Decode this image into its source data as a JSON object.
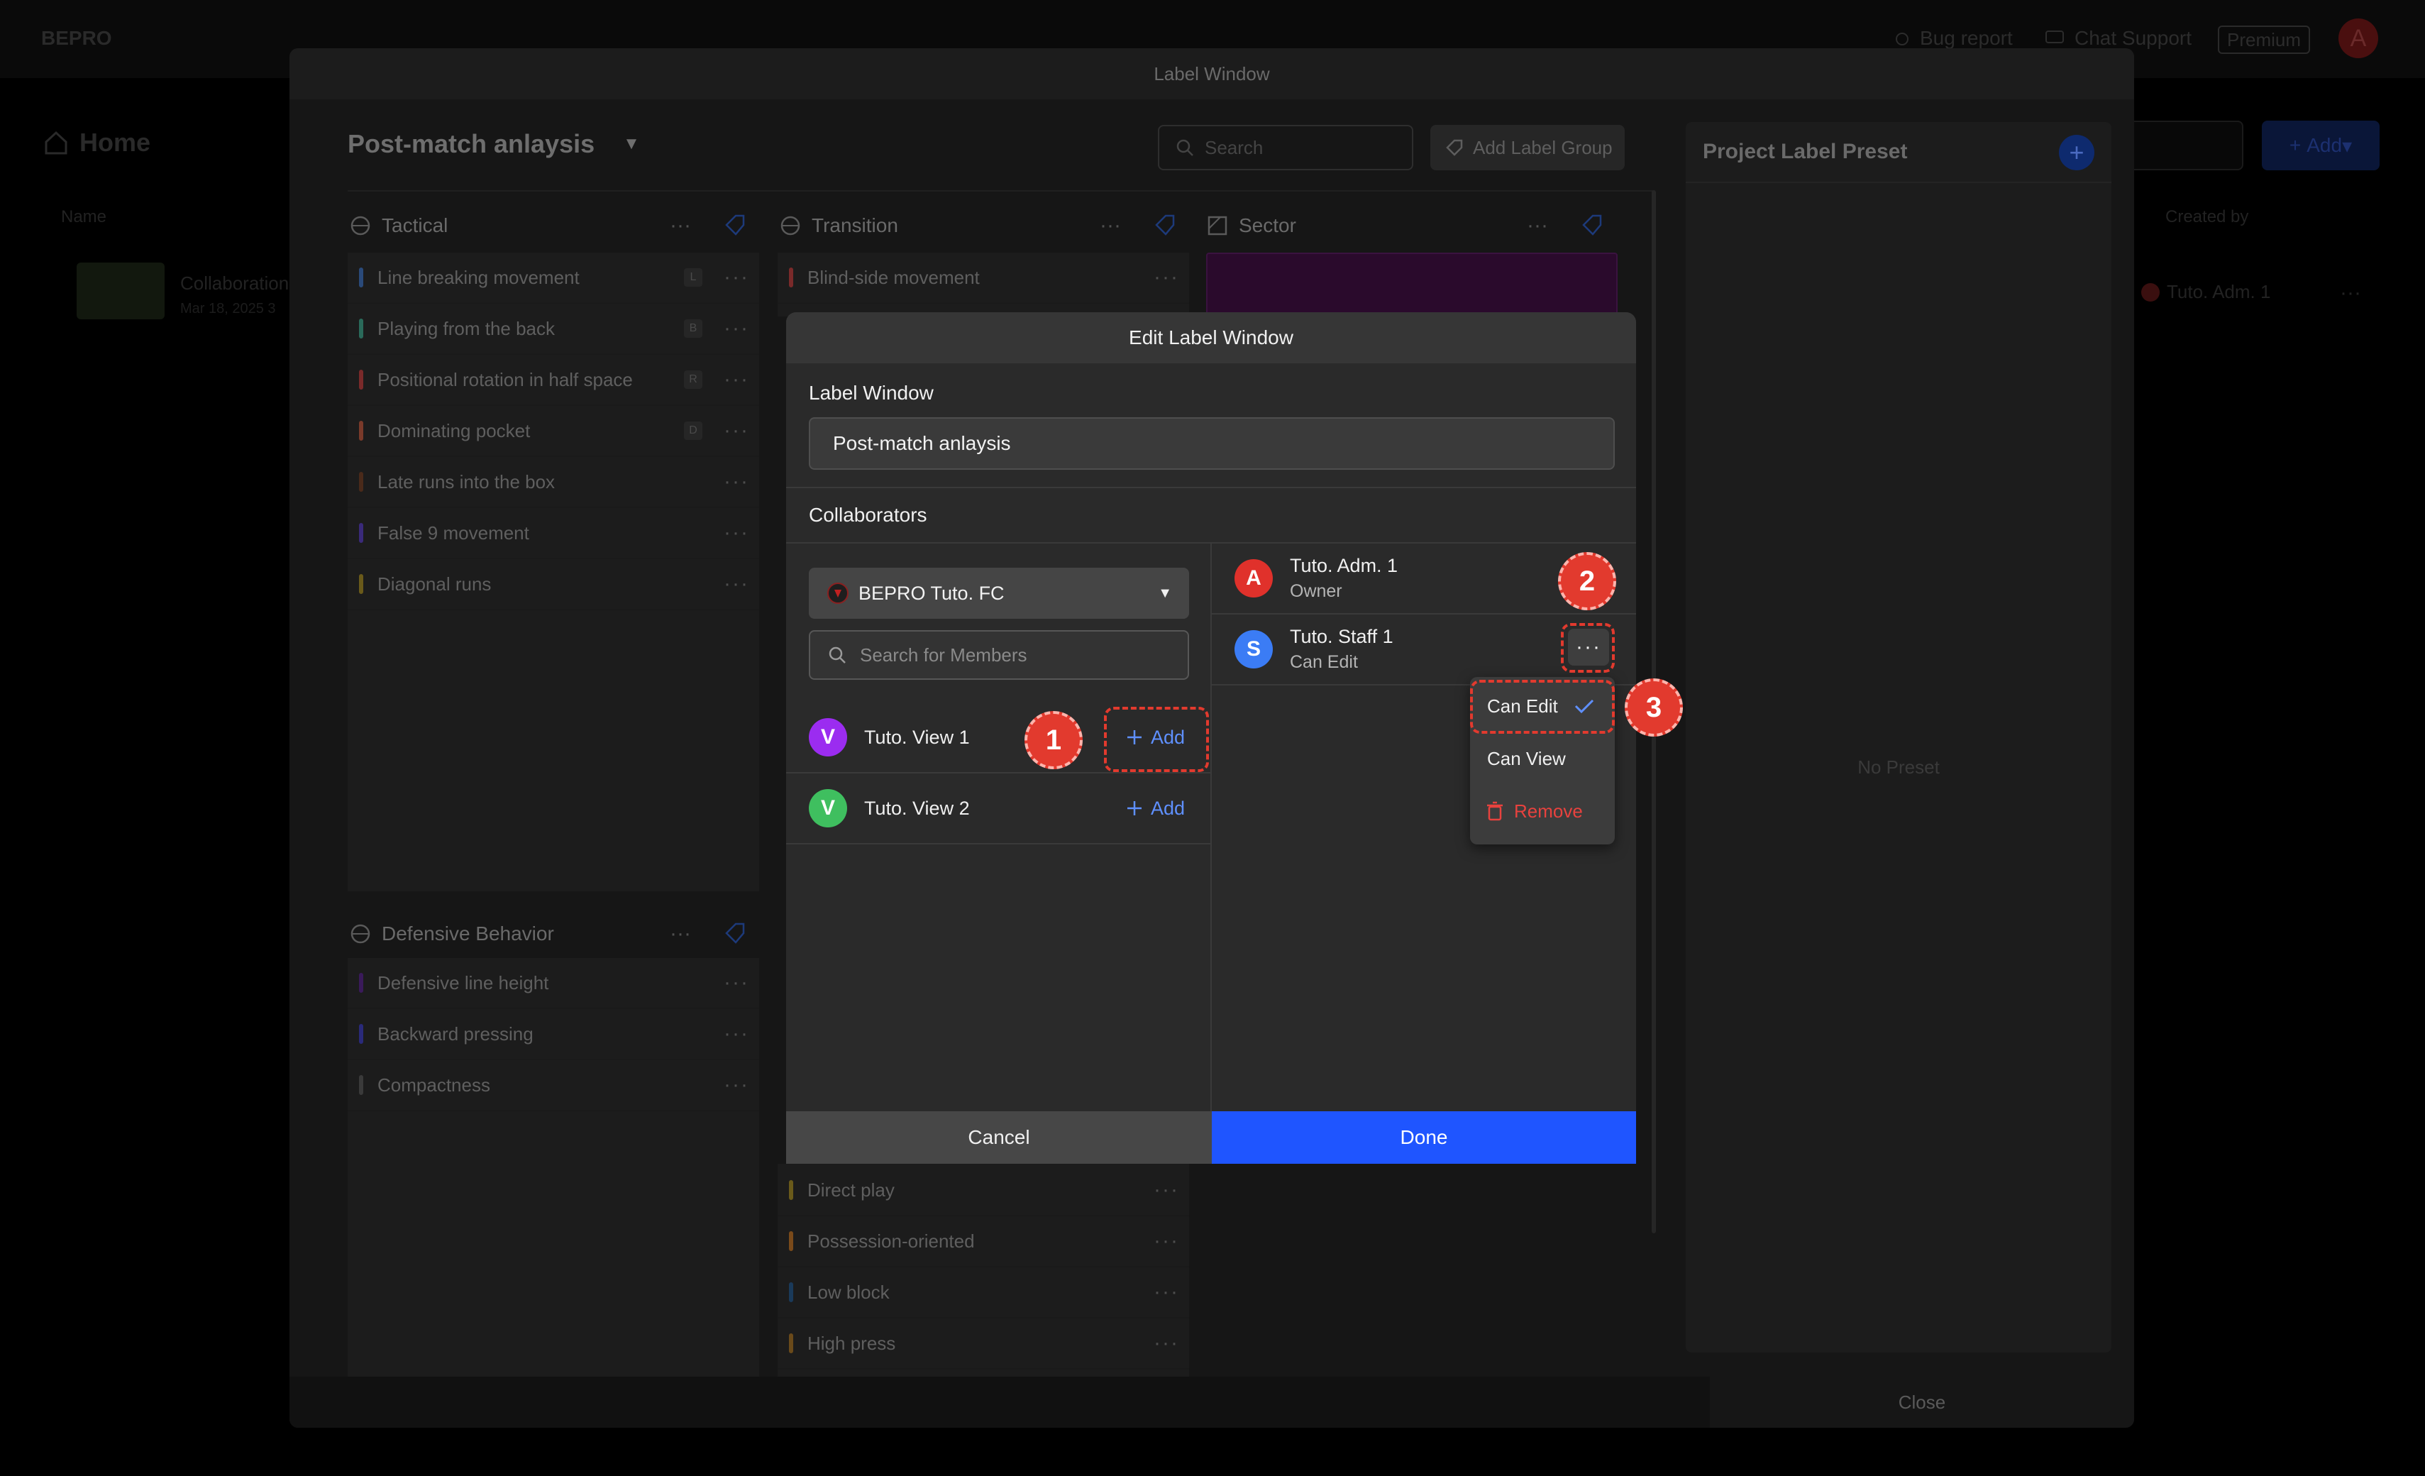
{
  "app": {
    "logo": "BEPRO",
    "bug_report": "Bug report",
    "chat_support": "Chat Support",
    "premium": "Premium",
    "avatar_initial": "A",
    "home": "Home",
    "col_name": "Name",
    "col_created": "Created by",
    "row_title": "Collaboration",
    "row_date": "Mar 18, 2025 3",
    "row_creator": "Tuto. Adm. 1",
    "add": "Add"
  },
  "label_window": {
    "title": "Label Window",
    "project_name": "Post-match anlaysis",
    "search_placeholder": "Search",
    "add_label_group": "Add Label Group",
    "close": "Close",
    "groups": {
      "tactical": {
        "name": "Tactical",
        "labels": [
          {
            "text": "Line breaking movement",
            "key": "L",
            "color": "#2a4a7a"
          },
          {
            "text": "Playing from the back",
            "key": "B",
            "color": "#2a6a5a"
          },
          {
            "text": "Positional rotation in half space",
            "key": "R",
            "color": "#7a2a2a"
          },
          {
            "text": "Dominating pocket",
            "key": "D",
            "color": "#7a3a2a"
          },
          {
            "text": "Late runs into the box",
            "key": "",
            "color": "#4a2a1a"
          },
          {
            "text": "False 9 movement",
            "key": "",
            "color": "#3a2a7a"
          },
          {
            "text": "Diagonal runs",
            "key": "",
            "color": "#6a5a1a"
          }
        ]
      },
      "transition": {
        "name": "Transition",
        "labels": [
          {
            "text": "Blind-side movement",
            "color": "#7a2a2a"
          }
        ]
      },
      "sector": {
        "name": "Sector"
      },
      "defensive": {
        "name": "Defensive Behavior",
        "labels": [
          {
            "text": "Defensive line height",
            "color": "#3a1a5a"
          },
          {
            "text": "Backward pressing",
            "color": "#2a2a7a"
          },
          {
            "text": "Compactness",
            "color": "#3a3a3a"
          }
        ]
      },
      "style": {
        "labels": [
          {
            "text": "Direct play",
            "color": "#6a5a1a"
          },
          {
            "text": "Possession-oriented",
            "color": "#7a4a1a"
          },
          {
            "text": "Low block",
            "color": "#1a3a5a"
          },
          {
            "text": "High press",
            "color": "#6a4a1a"
          }
        ]
      }
    },
    "preset": {
      "title": "Project Label Preset",
      "empty": "No Preset"
    }
  },
  "dialog": {
    "title": "Edit Label Window",
    "field_label": "Label Window",
    "field_value": "Post-match anlaysis",
    "collaborators": "Collaborators",
    "team": "BEPRO Tuto. FC",
    "member_search_placeholder": "Search for Members",
    "members": [
      {
        "initial": "V",
        "name": "Tuto. View 1",
        "add": "Add",
        "color": "#9b2cf0"
      },
      {
        "initial": "V",
        "name": "Tuto. View 2",
        "add": "Add",
        "color": "#3fbf5f"
      }
    ],
    "collaborator_list": [
      {
        "initial": "A",
        "name": "Tuto. Adm. 1",
        "role": "Owner",
        "color": "#e0312b"
      },
      {
        "initial": "S",
        "name": "Tuto. Staff 1",
        "role": "Can Edit",
        "color": "#3b7cf5"
      }
    ],
    "menu": {
      "can_edit": "Can Edit",
      "can_view": "Can View",
      "remove": "Remove"
    },
    "cancel": "Cancel",
    "done": "Done"
  },
  "annotations": {
    "step1": "1",
    "step2": "2",
    "step3": "3",
    "color": "#e23a2e"
  }
}
